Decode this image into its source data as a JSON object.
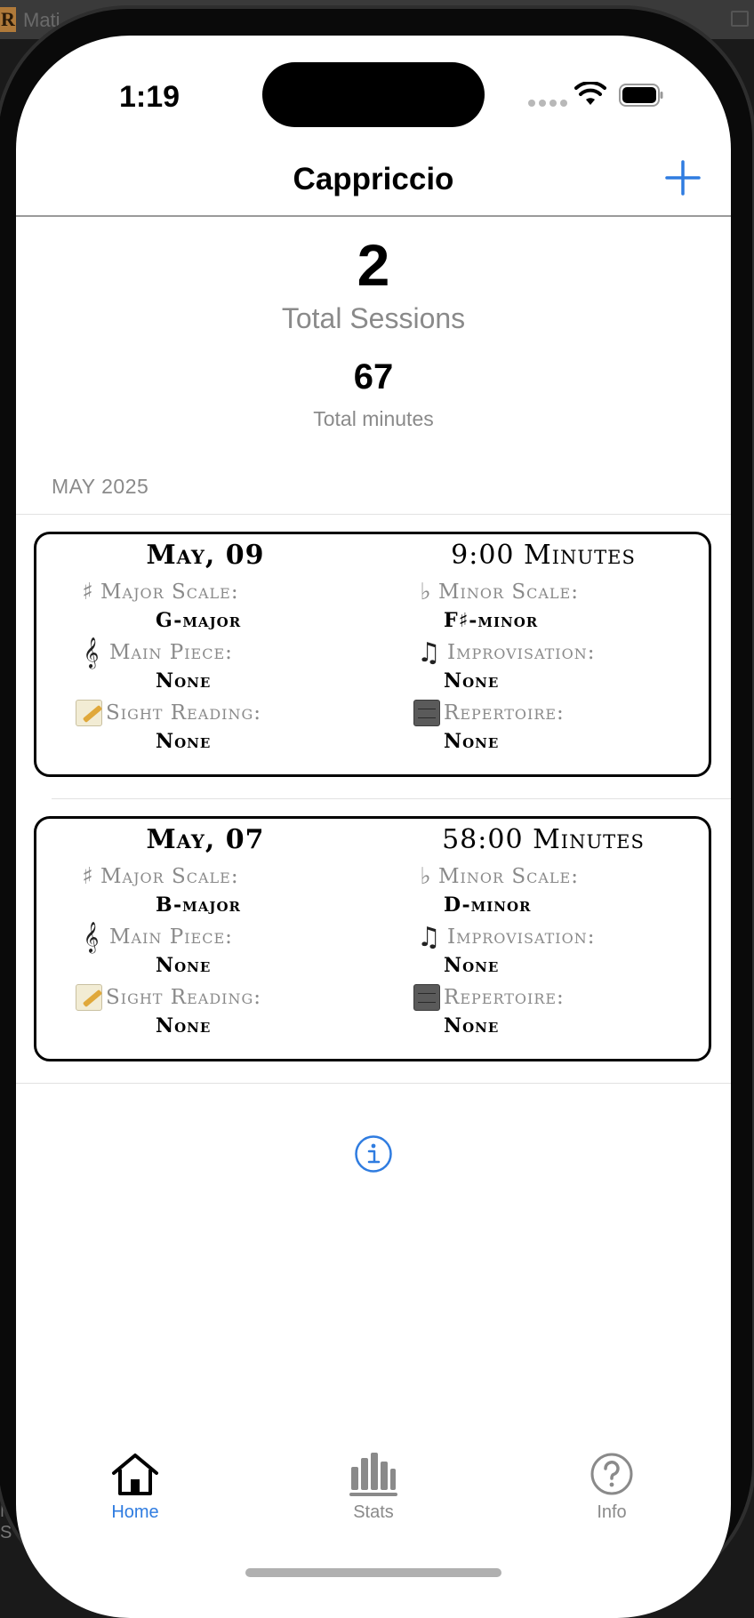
{
  "desktop": {
    "window_title": "Mati",
    "app_icon_letter": "R",
    "bottom_text": "N S"
  },
  "status_bar": {
    "time": "1:19"
  },
  "nav": {
    "title": "Cappriccio",
    "add_icon": "plus-icon"
  },
  "summary": {
    "total_sessions_value": "2",
    "total_sessions_label": "Total Sessions",
    "total_minutes_value": "67",
    "total_minutes_label": "Total minutes"
  },
  "section": {
    "header": "MAY 2025"
  },
  "sessions": [
    {
      "date": "May, 09",
      "minutes": "9:00 Minutes",
      "major_scale_label": "Major Scale:",
      "major_scale_value": "G-major",
      "minor_scale_label": "Minor Scale:",
      "minor_scale_value": "F♯-minor",
      "main_piece_label": "Main Piece:",
      "main_piece_value": "None",
      "improvisation_label": "Improvisation:",
      "improvisation_value": "None",
      "sight_reading_label": "Sight Reading:",
      "sight_reading_value": "None",
      "repertoire_label": "Repertoire:",
      "repertoire_value": "None"
    },
    {
      "date": "May, 07",
      "minutes": "58:00 Minutes",
      "major_scale_label": "Major Scale:",
      "major_scale_value": "B-major",
      "minor_scale_label": "Minor Scale:",
      "minor_scale_value": "D-minor",
      "main_piece_label": "Main Piece:",
      "main_piece_value": "None",
      "improvisation_label": "Improvisation:",
      "improvisation_value": "None",
      "sight_reading_label": "Sight Reading:",
      "sight_reading_value": "None",
      "repertoire_label": "Repertoire:",
      "repertoire_value": "None"
    }
  ],
  "icons": {
    "sharp": "♯",
    "flat": "♭",
    "treble_clef": "𝄞",
    "notes": "♫"
  },
  "tabs": [
    {
      "label": "Home",
      "icon": "house-icon",
      "active": true
    },
    {
      "label": "Stats",
      "icon": "bar-chart-icon",
      "active": false
    },
    {
      "label": "Info",
      "icon": "question-circle-icon",
      "active": false
    }
  ],
  "colors": {
    "accent": "#2f7ce0",
    "inactive_tab": "#8a8a8a",
    "secondary_text": "#8a8a8a"
  }
}
